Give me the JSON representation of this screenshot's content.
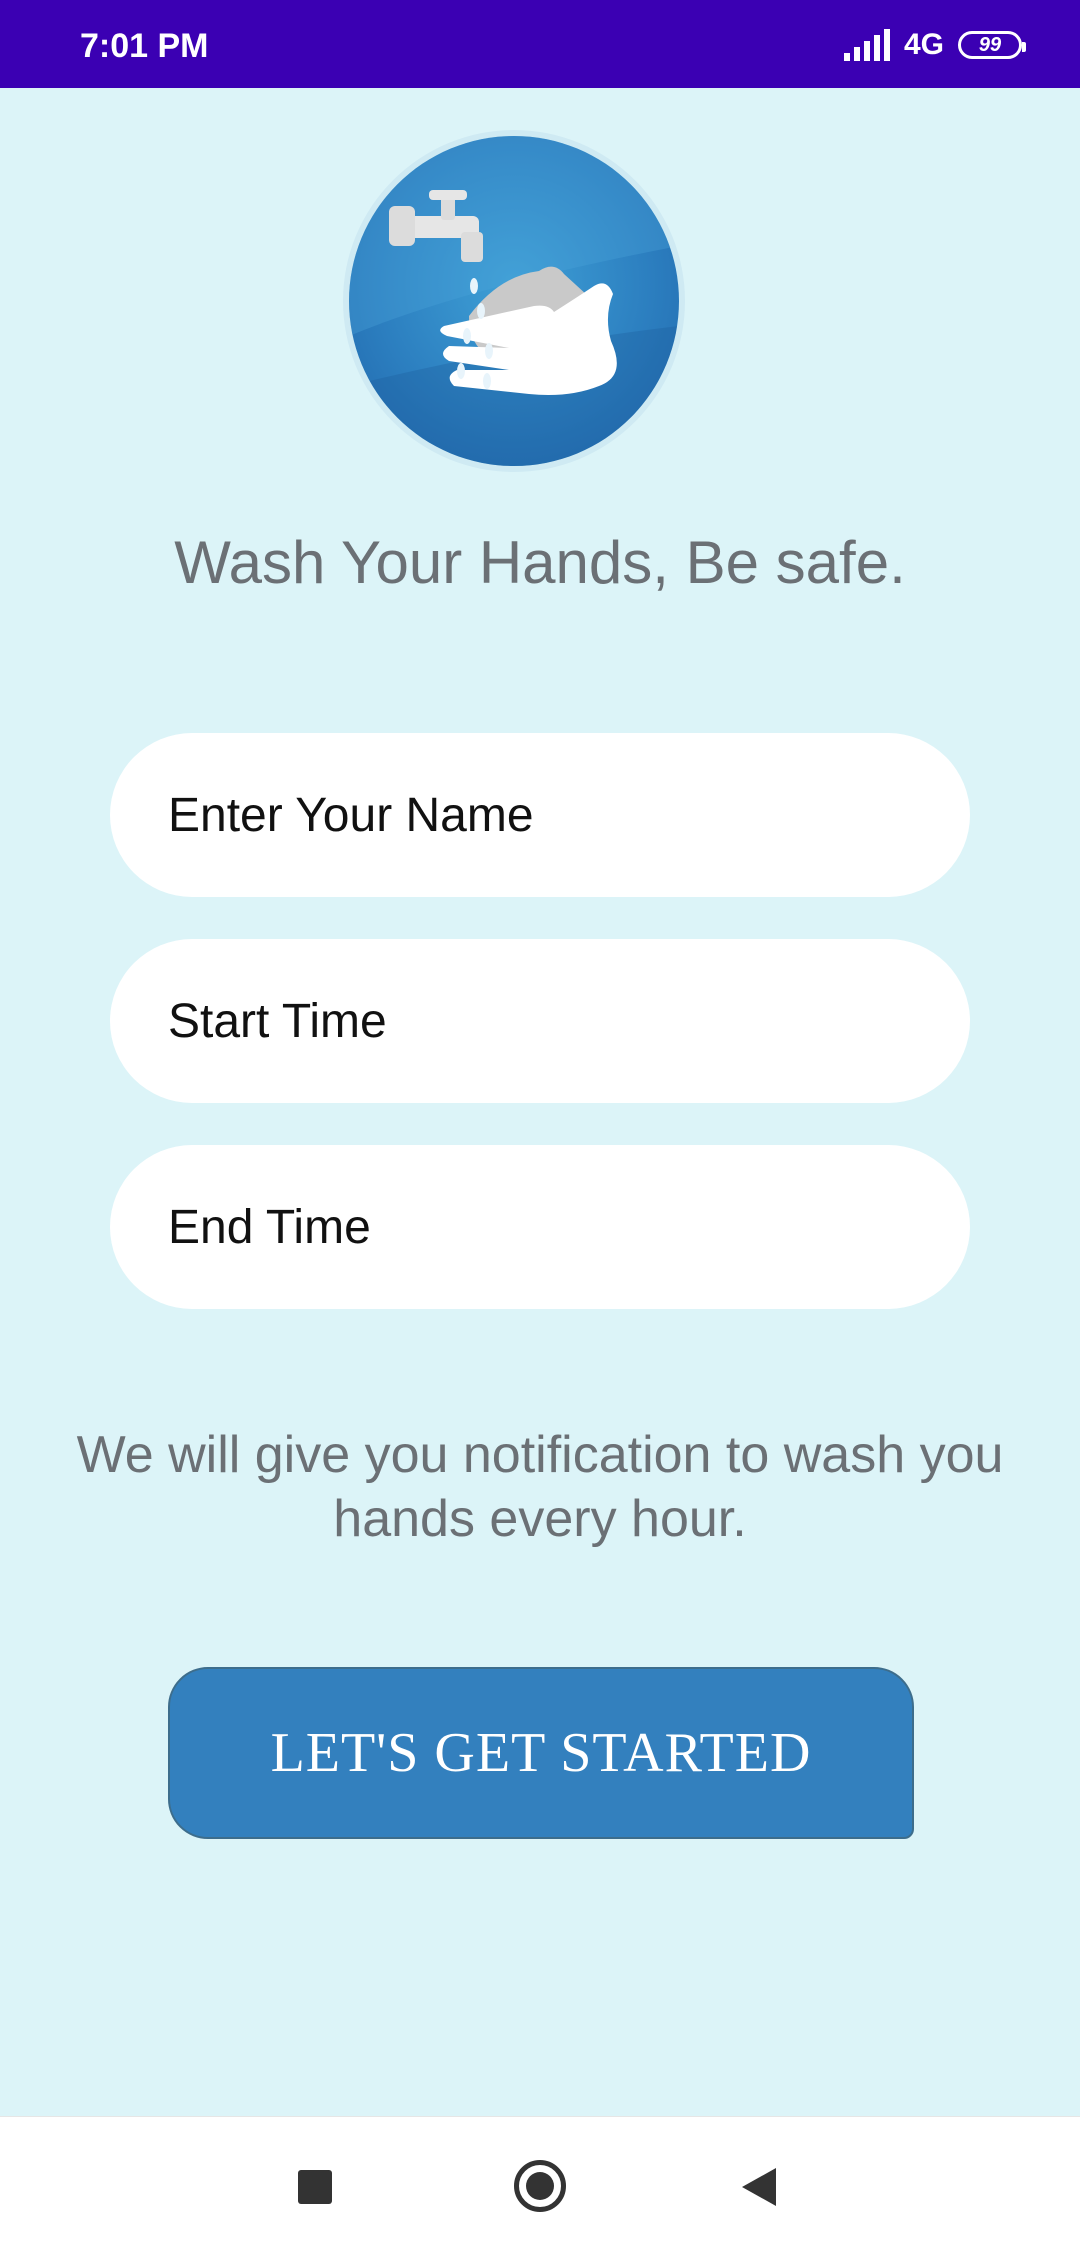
{
  "status_bar": {
    "time": "7:01 PM",
    "network": "4G",
    "battery": "99"
  },
  "logo": {
    "icon": "hand-washing-icon",
    "accent_color": "#2c7fc0"
  },
  "tagline": "Wash Your Hands, Be safe.",
  "form": {
    "name_placeholder": "Enter Your Name",
    "start_time_placeholder": "Start Time",
    "end_time_placeholder": "End Time"
  },
  "notice": "We will give you notification to wash you hands every hour.",
  "cta": {
    "label": "LET'S GET STARTED",
    "color": "#3380be"
  },
  "nav": {
    "recents_icon": "square-icon",
    "home_icon": "circle-icon",
    "back_icon": "triangle-back-icon"
  },
  "colors": {
    "status_bar": "#3b00b3",
    "background": "#dcf4f8",
    "text_muted": "#6b7075"
  }
}
